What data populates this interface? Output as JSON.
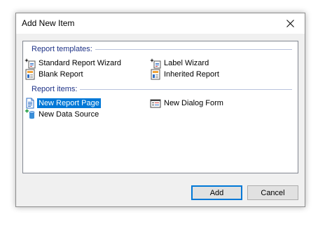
{
  "window": {
    "title": "Add New Item",
    "close_icon": "close-icon"
  },
  "groups": [
    {
      "header": "Report templates:",
      "items": [
        {
          "label": "Standard Report Wizard",
          "icon": "wizard-icon"
        },
        {
          "label": "Label Wizard",
          "icon": "wizard-icon"
        },
        {
          "label": "Blank Report",
          "icon": "report-icon"
        },
        {
          "label": "Inherited Report",
          "icon": "report-icon"
        }
      ]
    },
    {
      "header": "Report items:",
      "items": [
        {
          "label": "New Report Page",
          "icon": "page-icon",
          "selected": true
        },
        {
          "label": "New Dialog Form",
          "icon": "dialog-form-icon"
        },
        {
          "label": "New Data Source",
          "icon": "database-add-icon"
        }
      ]
    }
  ],
  "buttons": {
    "add": "Add",
    "cancel": "Cancel"
  },
  "colors": {
    "selection": "#0078d7",
    "group_header": "#1e3287",
    "dialog_bg": "#f0f0f0"
  }
}
